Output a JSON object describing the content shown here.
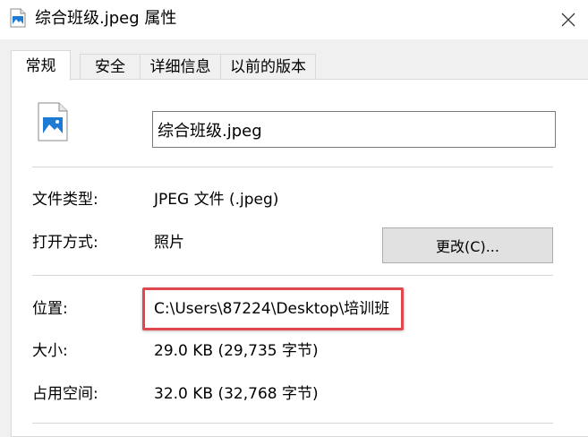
{
  "window": {
    "title": "综合班级.jpeg 属性",
    "close_icon": "close-icon",
    "file_icon": "image-file-icon"
  },
  "tabs": [
    {
      "label": "常规",
      "active": true
    },
    {
      "label": "安全",
      "active": false
    },
    {
      "label": "详细信息",
      "active": false
    },
    {
      "label": "以前的版本",
      "active": false
    }
  ],
  "general": {
    "file_name": "综合班级.jpeg",
    "file_type_label": "文件类型:",
    "file_type_value": "JPEG 文件 (.jpeg)",
    "opens_with_label": "打开方式:",
    "opens_with_value": "照片",
    "change_button_label": "更改(C)...",
    "location_label": "位置:",
    "location_value": "C:\\Users\\87224\\Desktop\\培训班",
    "size_label": "大小:",
    "size_value": "29.0 KB (29,735 字节)",
    "size_on_disk_label": "占用空间:",
    "size_on_disk_value": "32.0 KB (32,768 字节)"
  },
  "colors": {
    "highlight_border": "#e0484d",
    "icon_blue": "#1e7bd4"
  }
}
